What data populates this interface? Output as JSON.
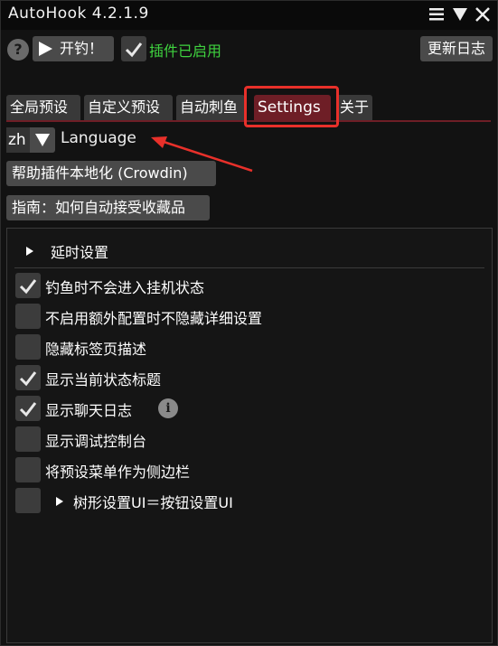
{
  "window": {
    "title": "AutoHook 4.2.1.9"
  },
  "toolbar": {
    "help_symbol": "?",
    "start_label": "开钓！",
    "plugin_enabled_label": "插件已启用",
    "plugin_enabled": true,
    "changelog_label": "更新日志"
  },
  "tabs": [
    {
      "label": "全局预设",
      "active": false
    },
    {
      "label": "自定义预设",
      "active": false
    },
    {
      "label": "自动刺鱼",
      "active": false
    },
    {
      "label": "Settings",
      "active": true
    },
    {
      "label": "关于",
      "active": false
    }
  ],
  "settings": {
    "language_value": "zh",
    "language_label": "Language",
    "crowdin_button": "帮助插件本地化 (Crowdin)",
    "guide_button": "指南：如何自动接受收藏品",
    "delay_header": "延时设置",
    "options": [
      {
        "label": "钓鱼时不会进入挂机状态",
        "checked": true
      },
      {
        "label": "不启用额外配置时不隐藏详细设置",
        "checked": false
      },
      {
        "label": "隐藏标签页描述",
        "checked": false
      },
      {
        "label": "显示当前状态标题",
        "checked": true
      },
      {
        "label": "显示聊天日志",
        "checked": true,
        "info": "i"
      },
      {
        "label": "显示调试控制台",
        "checked": false
      },
      {
        "label": "将预设菜单作为侧边栏",
        "checked": false
      },
      {
        "label": "树形设置UI＝按钮设置UI",
        "checked": false
      }
    ]
  },
  "colors": {
    "accent_tab": "#6e1e26",
    "enabled_green": "#3fd13f",
    "annotation_red": "#e8302a"
  }
}
